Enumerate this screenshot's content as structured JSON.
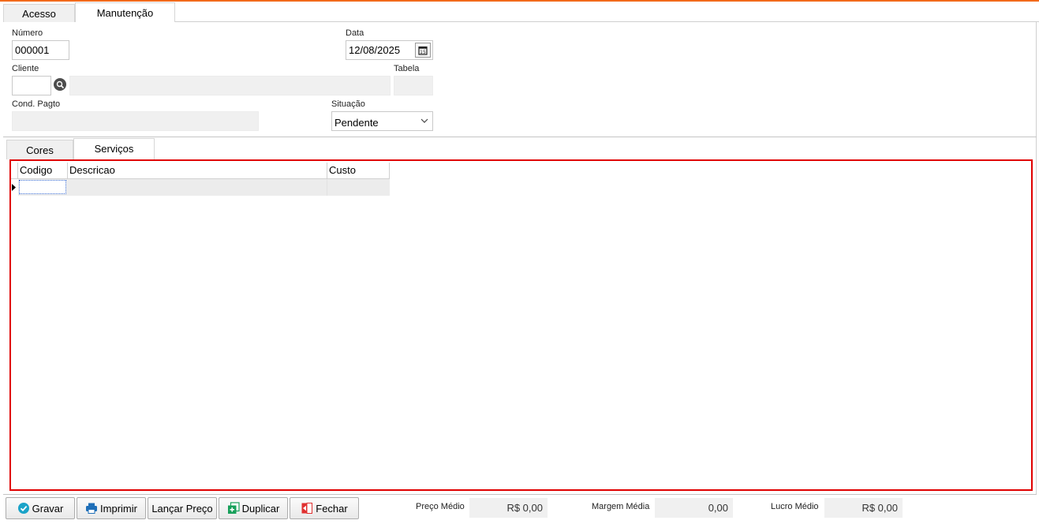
{
  "main_tabs": [
    {
      "label": "Acesso",
      "active": false
    },
    {
      "label": "Manutenção",
      "active": true
    }
  ],
  "form": {
    "numero_label": "Número",
    "numero_value": "000001",
    "data_label": "Data",
    "data_value": "12/08/2025",
    "cliente_label": "Cliente",
    "cliente_value": "",
    "cliente_nome_value": "",
    "tabela_label": "Tabela",
    "tabela_value": "",
    "cond_pagto_label": "Cond. Pagto",
    "cond_pagto_value": "",
    "situacao_label": "Situação",
    "situacao_value": "Pendente"
  },
  "sub_tabs": [
    {
      "label": "Cores",
      "active": false
    },
    {
      "label": "Serviços",
      "active": true
    }
  ],
  "grid": {
    "columns": [
      "Codigo",
      "Descricao",
      "Custo"
    ],
    "rows": [
      [
        "",
        "",
        ""
      ]
    ]
  },
  "buttons": {
    "gravar": "Gravar",
    "imprimir": "Imprimir",
    "lancar_preco": "Lançar Preço",
    "duplicar": "Duplicar",
    "fechar": "Fechar"
  },
  "summary": {
    "preco_medio_label": "Preço Médio",
    "preco_medio_value": "R$ 0,00",
    "margem_media_label": "Margem Média",
    "margem_media_value": "0,00",
    "lucro_medio_label": "Lucro Médio",
    "lucro_medio_value": "R$ 0,00"
  },
  "colors": {
    "accent_bar": "#f26a1b",
    "highlight_border": "#e00000"
  }
}
